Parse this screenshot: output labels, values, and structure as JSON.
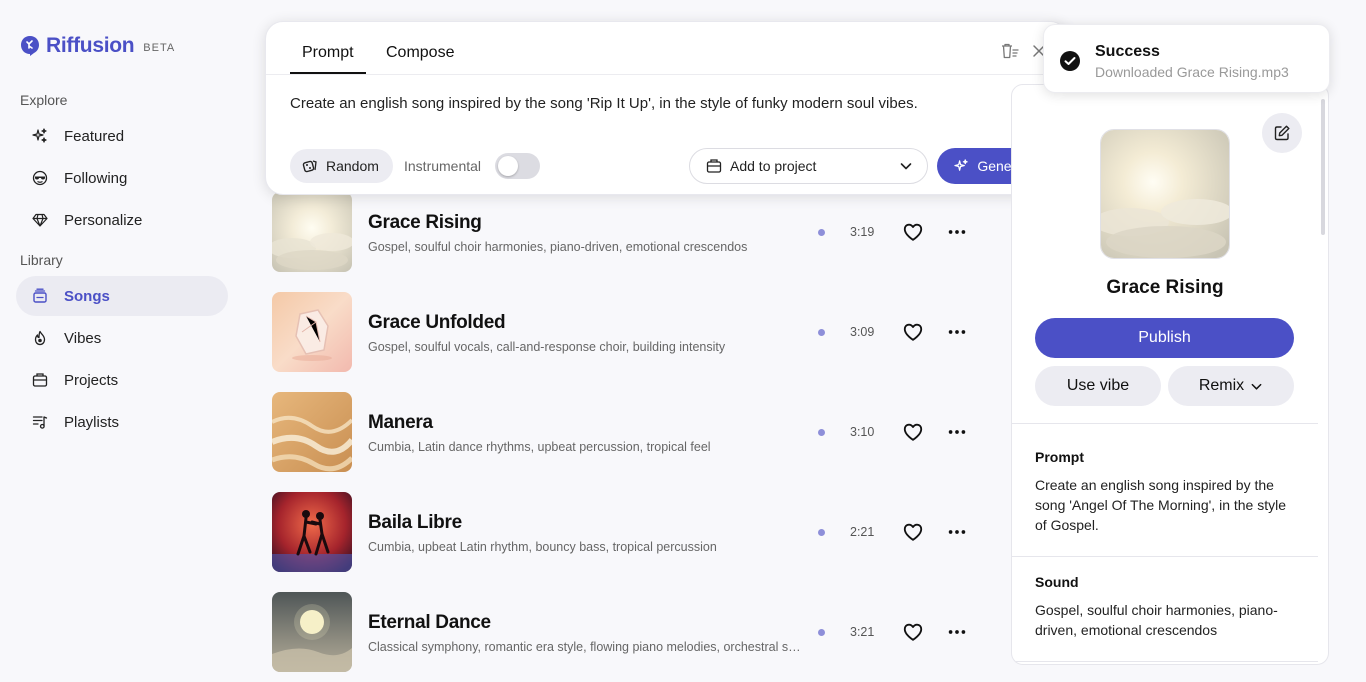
{
  "brand": {
    "name": "Riffusion",
    "badge": "BETA",
    "accent": "#4b50c6"
  },
  "sidebar": {
    "explore_label": "Explore",
    "explore_items": [
      {
        "label": "Featured",
        "icon": "sparkle-icon"
      },
      {
        "label": "Following",
        "icon": "sunglasses-face-icon"
      },
      {
        "label": "Personalize",
        "icon": "gem-icon"
      }
    ],
    "library_label": "Library",
    "library_items": [
      {
        "label": "Songs",
        "icon": "library-icon",
        "active": true
      },
      {
        "label": "Vibes",
        "icon": "fire-icon"
      },
      {
        "label": "Projects",
        "icon": "folder-icon"
      },
      {
        "label": "Playlists",
        "icon": "playlist-icon"
      }
    ]
  },
  "prompt_card": {
    "tabs": [
      "Prompt",
      "Compose"
    ],
    "active_tab": "Prompt",
    "prompt_text": "Create an english song inspired by the song 'Rip It Up', in the style of funky modern soul vibes.",
    "random_label": "Random",
    "instrumental_label": "Instrumental",
    "instrumental_on": false,
    "project_select": "Add to project",
    "generate_label": "Generate"
  },
  "songs": [
    {
      "title": "Grace Rising",
      "desc": "Gospel, soulful choir harmonies, piano-driven, emotional crescendos",
      "duration": "3:19"
    },
    {
      "title": "Grace Unfolded",
      "desc": "Gospel, soulful vocals, call-and-response choir, building intensity",
      "duration": "3:09"
    },
    {
      "title": "Manera",
      "desc": "Cumbia, Latin dance rhythms, upbeat percussion, tropical feel",
      "duration": "3:10"
    },
    {
      "title": "Baila Libre",
      "desc": "Cumbia, upbeat Latin rhythm, bouncy bass, tropical percussion",
      "duration": "2:21"
    },
    {
      "title": "Eternal Dance",
      "desc": "Classical symphony, romantic era style, flowing piano melodies, orchestral swells",
      "duration": "3:21"
    }
  ],
  "detail": {
    "title": "Grace Rising",
    "publish_label": "Publish",
    "use_vibe_label": "Use vibe",
    "remix_label": "Remix",
    "prompt_heading": "Prompt",
    "prompt_text": "Create an english song inspired by the song 'Angel Of The Morning', in the style of Gospel.",
    "sound_heading": "Sound",
    "sound_text": "Gospel, soulful choir harmonies, piano-driven, emotional crescendos"
  },
  "toast": {
    "title": "Success",
    "message": "Downloaded Grace Rising.mp3"
  }
}
